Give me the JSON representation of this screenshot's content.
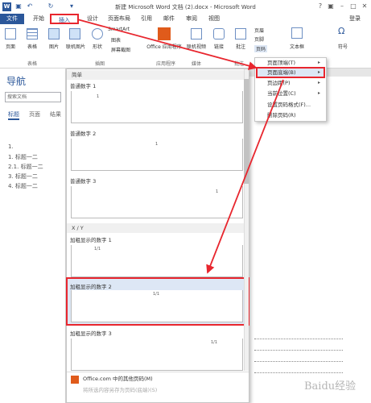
{
  "titlebar": {
    "title": "新建 Microsoft Word 文档 (2).docx - Microsoft Word",
    "app_icon": "W",
    "login": "登录"
  },
  "tabs": [
    "文件",
    "开始",
    "插入",
    "设计",
    "页面布局",
    "引用",
    "邮件",
    "审阅",
    "视图"
  ],
  "ribbon": {
    "pages": "页面",
    "table": "表格",
    "picture": "图片",
    "online_picture": "联机图片",
    "shapes": "形状",
    "smartart": "SmartArt",
    "chart": "图表",
    "screenshot": "屏幕截图",
    "office_apps": "Office 应用程序",
    "online_video": "联机视频",
    "link": "链接",
    "comment": "批注",
    "header": "页眉",
    "footer": "页脚",
    "page_number": "页码",
    "textbox": "文本框",
    "symbol": "符号",
    "groups": {
      "tables": "表格",
      "illustrations": "插图",
      "apps": "应用程序",
      "media": "媒体",
      "comments": "批注"
    }
  },
  "nav": {
    "title": "导航",
    "search_placeholder": "搜索文档",
    "tabs": [
      "标题",
      "页面",
      "结果"
    ],
    "outline": [
      "1.",
      "1. 标题一二",
      "2.1. 标题一二",
      "3. 标题一二",
      "4. 标题一二"
    ]
  },
  "dropdown": {
    "section_simple": "简单",
    "section_xy": "X / Y",
    "galleries": [
      {
        "name": "普通数字 1",
        "number": "1"
      },
      {
        "name": "普通数字 2",
        "number": "1"
      },
      {
        "name": "普通数字 3",
        "number": "1"
      },
      {
        "name": "加粗显示的数字 1",
        "number": "1/1"
      },
      {
        "name": "加粗显示的数字 2",
        "number": "1/1"
      },
      {
        "name": "加粗显示的数字 3",
        "number": "1/1"
      }
    ],
    "more": "Office.com 中的其他页码(M)",
    "save": "将所选内容另存为页码(底端)(S)"
  },
  "context_menu": {
    "items": [
      "页面顶端(T)",
      "页面底端(B)",
      "页边距(P)",
      "当前位置(C)",
      "设置页码格式(F)...",
      "删除页码(R)"
    ]
  },
  "watermark": "Baidu经验",
  "colors": {
    "accent": "#2b579a",
    "highlight": "#e8262e"
  }
}
